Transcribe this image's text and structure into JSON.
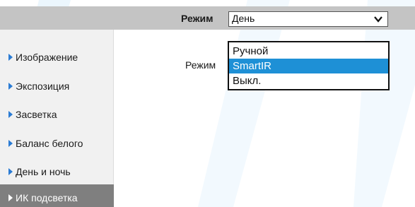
{
  "header": {
    "mode_label": "Режим",
    "mode_value": "День"
  },
  "sidebar": {
    "items": [
      {
        "label": "Изображение"
      },
      {
        "label": "Экспозиция"
      },
      {
        "label": "Засветка"
      },
      {
        "label": "Баланс белого"
      },
      {
        "label": "День и ночь"
      },
      {
        "label": "ИК подсветка",
        "active": true
      }
    ]
  },
  "main": {
    "mode_label": "Режим",
    "dropdown": {
      "options": [
        "Ручной",
        "SmartIR",
        "Выкл."
      ],
      "selected": "SmartIR"
    }
  },
  "colors": {
    "header_bg": "#c4c4c4",
    "sidebar_bg": "#f1f1f1",
    "active_item_bg": "#7f7f7f",
    "accent": "#1e90d6",
    "arrow": "#2a7bd4"
  }
}
